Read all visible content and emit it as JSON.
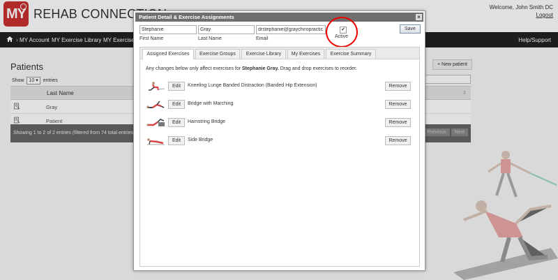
{
  "app": {
    "logo_text": "MY",
    "brand_name": "REHAB CONNECTION",
    "welcome": "Welcome, John Smith DC",
    "logout": "Logout"
  },
  "nav": {
    "items": [
      "MY Account",
      "MY Exercise Library",
      "MY Exercise C"
    ],
    "help": "Help/Support"
  },
  "patients": {
    "title": "Patients",
    "new_patient": "+ New patient",
    "show": "Show",
    "entries_value": "10",
    "entries": "entries",
    "column_header": "Last Name",
    "rows": [
      {
        "last_name": "Gray"
      },
      {
        "last_name": "Patient"
      }
    ],
    "showing": "Showing 1 to 2 of 2 entries (filtered from 74 total entries)",
    "pager_prev": "Previous",
    "pager_next": "Next"
  },
  "modal": {
    "title": "Patient Detail & Exercise Assignments",
    "close": "×",
    "first_name_value": "Stephanie",
    "first_name_label": "First Name",
    "last_name_value": "Gray",
    "last_name_label": "Last Name",
    "email_value": "drstephanie@graychiropractic.ca",
    "email_label": "Email",
    "active_check": "✔",
    "active_label": "Active",
    "save": "Save",
    "tabs": [
      "Assigned Exercises",
      "Exercise Groups",
      "Exercise Library",
      "My Exercises",
      "Exercise Summary"
    ],
    "note_prefix": "Any changes below only affect exercises for ",
    "note_name": "Stephanie Gray.",
    "note_suffix": " Drag and drop exercises to reorder.",
    "edit": "Edit",
    "remove": "Remove",
    "exercises": [
      {
        "name": "Kneeling Lunge Banded Distraction (Banded Hip Extension)"
      },
      {
        "name": "Bridge with Marching"
      },
      {
        "name": "Hamstring Bridge"
      },
      {
        "name": "Side Bridge"
      }
    ]
  },
  "colors": {
    "brand_red": "#c8302f",
    "nav_bg": "#222222",
    "modal_titlebar": "#6f6f6f",
    "highlight_circle": "#ee0000"
  }
}
